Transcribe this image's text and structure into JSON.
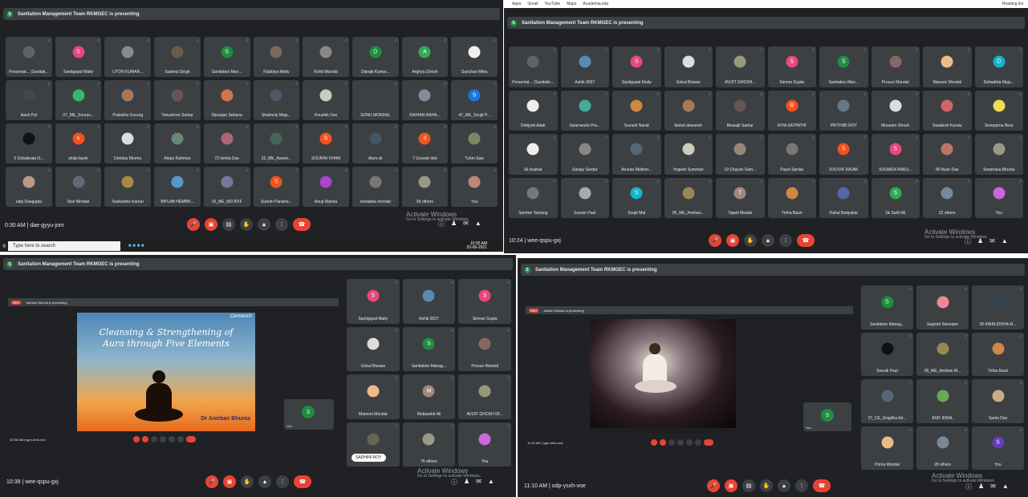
{
  "bookmarks": {
    "items": [
      "Apps",
      "Gmail",
      "YouTube",
      "Maps",
      "Academia.edu"
    ],
    "reading_list": "Reading list"
  },
  "presenting": "Sanitation Management Team RKMGEC is presenting",
  "activate": {
    "title": "Activate Windows",
    "sub": "Go to Settings to activate Windows."
  },
  "panel1": {
    "meeting": "0:30 AM | dae-gyyu-jom",
    "taskbar_search": "Type here to search",
    "taskbar_time": "10:30 AM",
    "taskbar_date": "20-06-2021",
    "tiles": [
      {
        "name": "Presentat... (Sanitati...",
        "letter": "",
        "color": "#5f6368"
      },
      {
        "name": "Santigopal Maity",
        "letter": "S",
        "color": "#e8477b"
      },
      {
        "name": "LITON KUMAR...",
        "letter": "",
        "color": "#8a8a8a"
      },
      {
        "name": "Sudeep Singh",
        "letter": "",
        "color": "#6b5b4a"
      },
      {
        "name": "Sanitation Man...",
        "letter": "S",
        "color": "#1e8e3e"
      },
      {
        "name": "Flabbiya Maity",
        "letter": "",
        "color": "#7a6a55"
      },
      {
        "name": "Rohit Mondal",
        "letter": "",
        "color": "#888"
      },
      {
        "name": "Diprajit Kumar...",
        "letter": "D",
        "color": "#1e8e3e"
      },
      {
        "name": "Arghya Ghosh",
        "letter": "A",
        "color": "#34a853"
      },
      {
        "name": "Sanchari Mitra",
        "letter": "",
        "color": "#eee"
      },
      {
        "name": "ikash Pal",
        "letter": "",
        "color": "#445"
      },
      {
        "name": "07_ME_Sourav...",
        "letter": "",
        "color": "#3b6"
      },
      {
        "name": "Pratistha Gurung",
        "letter": "",
        "color": "#a75"
      },
      {
        "name": "Tanushree Sarkar",
        "letter": "",
        "color": "#655"
      },
      {
        "name": "Dipanjan Sahana",
        "letter": "",
        "color": "#c74"
      },
      {
        "name": "Shalmoly Maju...",
        "letter": "",
        "color": "#556"
      },
      {
        "name": "Koushik Das",
        "letter": "",
        "color": "#ccb"
      },
      {
        "name": "SONU MONDAL",
        "letter": "",
        "color": "#3c4043"
      },
      {
        "name": "RAIHAN RAHA...",
        "letter": "",
        "color": "#889"
      },
      {
        "name": "47_ME_Soujit P...",
        "letter": "S",
        "color": "#1a73e8"
      },
      {
        "name": "0 Debabrata D...",
        "letter": "",
        "color": "#111"
      },
      {
        "name": "shilpi layek",
        "letter": "s",
        "color": "#f4511e"
      },
      {
        "name": "Debdas Murmu",
        "letter": "",
        "color": "#ddd"
      },
      {
        "name": "Atiqur Rahman",
        "letter": "",
        "color": "#687"
      },
      {
        "name": "72 Ismita Das",
        "letter": "",
        "color": "#a67"
      },
      {
        "name": "32_ME_Aswini...",
        "letter": "",
        "color": "#465"
      },
      {
        "name": "SOURAV KHAN",
        "letter": "S",
        "color": "#f4511e"
      },
      {
        "name": "Alam sk",
        "letter": "",
        "color": "#456"
      },
      {
        "name": "7 Gourab deb",
        "letter": "d",
        "color": "#f4511e"
      },
      {
        "name": "Tuhin Saw",
        "letter": "",
        "color": "#786"
      },
      {
        "name": "udip Dasgupta",
        "letter": "",
        "color": "#b98"
      },
      {
        "name": "Sisir Mondal",
        "letter": "",
        "color": "#667"
      },
      {
        "name": "Snahashis Kanrar",
        "letter": "",
        "color": "#a84"
      },
      {
        "name": "BIPLAB HEMBR...",
        "letter": "",
        "color": "#59c"
      },
      {
        "name": "19_ME_MD ATIF",
        "letter": "",
        "color": "#779"
      },
      {
        "name": "Suresh Parama...",
        "letter": "S",
        "color": "#f4511e"
      },
      {
        "name": "Anup Manna",
        "letter": "",
        "color": "#a4c"
      },
      {
        "name": "monalisa mondal",
        "letter": "",
        "color": "#777"
      },
      {
        "name": "56 others",
        "letter": "",
        "color": "#998"
      },
      {
        "name": "You",
        "letter": "",
        "color": "#b87"
      }
    ]
  },
  "panel2": {
    "meeting": "10:24 | wee-qspu-gxj",
    "tiles": [
      {
        "name": "Presentat... (Sanitatio...",
        "letter": "",
        "color": "#5f6368"
      },
      {
        "name": "Ashik 9037",
        "letter": "",
        "color": "#5a8ab0"
      },
      {
        "name": "Santigopal Maity",
        "letter": "S",
        "color": "#e8477b"
      },
      {
        "name": "Gokul Biswas",
        "letter": "",
        "color": "#ddd"
      },
      {
        "name": "AVIJIT GHOSH...",
        "letter": "",
        "color": "#997"
      },
      {
        "name": "Simran Gupta",
        "letter": "S",
        "color": "#e8477b"
      },
      {
        "name": "Sanitation Man...",
        "letter": "S",
        "color": "#1e8e3e"
      },
      {
        "name": "Prosun Mandal",
        "letter": "",
        "color": "#866"
      },
      {
        "name": "Mamoni Mondal",
        "letter": "",
        "color": "#eb8"
      },
      {
        "name": "Debadrita Maju...",
        "letter": "D",
        "color": "#12b5cb"
      },
      {
        "name": "Debjyoti Adak",
        "letter": "",
        "color": "#eee"
      },
      {
        "name": "Swarnendu Pra...",
        "letter": "",
        "color": "#4a9"
      },
      {
        "name": "Suvanil Nandi",
        "letter": "",
        "color": "#c84"
      },
      {
        "name": "bishal dewansh",
        "letter": "",
        "color": "#a75"
      },
      {
        "name": "Biswajit Sarkar",
        "letter": "",
        "color": "#655"
      },
      {
        "name": "RIYA SATPATHI",
        "letter": "R",
        "color": "#f4511e"
      },
      {
        "name": "PRITHIBI ROY",
        "letter": "",
        "color": "#678"
      },
      {
        "name": "Mousam Ghosh",
        "letter": "",
        "color": "#ddd"
      },
      {
        "name": "Swadesh Kundu",
        "letter": "",
        "color": "#c66"
      },
      {
        "name": "Sreeparna Bera",
        "letter": "",
        "color": "#ed5"
      },
      {
        "name": "Sk Azahar",
        "letter": "",
        "color": "#eee"
      },
      {
        "name": "Sanjay Sardar",
        "letter": "",
        "color": "#888"
      },
      {
        "name": "Anuran Mukher...",
        "letter": "",
        "color": "#567"
      },
      {
        "name": "Yogesh Summan",
        "letter": "",
        "color": "#ccb"
      },
      {
        "name": "19 Chayan Sam...",
        "letter": "",
        "color": "#987"
      },
      {
        "name": "Payel Sardar",
        "letter": "",
        "color": "#777"
      },
      {
        "name": "SOUVIK RAJAK",
        "letter": "S",
        "color": "#f4511e"
      },
      {
        "name": "SOUMEN ANKU...",
        "letter": "S",
        "color": "#e8477b"
      },
      {
        "name": "80 Ayan Das",
        "letter": "",
        "color": "#b76"
      },
      {
        "name": "Swarnava Bhunia",
        "letter": "",
        "color": "#998"
      },
      {
        "name": "Samten Tamang",
        "letter": "",
        "color": "#777"
      },
      {
        "name": "Suman Paul",
        "letter": "",
        "color": "#aaa"
      },
      {
        "name": "Soujit Mal",
        "letter": "S",
        "color": "#12b5cb"
      },
      {
        "name": "05_ME_Anirban...",
        "letter": "",
        "color": "#985"
      },
      {
        "name": "Tapati Modak",
        "letter": "T",
        "color": "#a1887f"
      },
      {
        "name": "Tirtha Bauri",
        "letter": "",
        "color": "#c84"
      },
      {
        "name": "Rahul Badyakar",
        "letter": "",
        "color": "#56a"
      },
      {
        "name": "Sk Sahil Ali",
        "letter": "S",
        "color": "#34a853"
      },
      {
        "name": "22 others",
        "letter": "",
        "color": "#789"
      },
      {
        "name": "You",
        "letter": "",
        "color": "#c6d"
      }
    ]
  },
  "panel3": {
    "meeting": "10:38 | wee-qspu-gxj",
    "rec": "REC",
    "presenter_note": "Anirban Bhunia is presenting",
    "slide_title": "Cleansing & Strengthening of Aura through Five Elements",
    "slide_author": "Dr Anirban Bhunia",
    "slide_logo": "Cemetrich",
    "inner_meeting": "10:36 AM | sgm-hrhs-ncd",
    "you": "You",
    "sadhini": "SADHINI ROY",
    "tiles": [
      {
        "name": "Santigopal Maity",
        "letter": "S",
        "color": "#e8477b"
      },
      {
        "name": "Ashik 9037",
        "letter": "",
        "color": "#5a8ab0"
      },
      {
        "name": "Simran Gupta",
        "letter": "S",
        "color": "#e8477b"
      },
      {
        "name": "Gokul Biswas",
        "letter": "",
        "color": "#ddd"
      },
      {
        "name": "Sanitation Manag...",
        "letter": "S",
        "color": "#1e8e3e"
      },
      {
        "name": "Prosun Mandal",
        "letter": "",
        "color": "#866"
      },
      {
        "name": "Mamoni Mondal",
        "letter": "",
        "color": "#eb8"
      },
      {
        "name": "Mubasshir Ali",
        "letter": "M",
        "color": "#a1887f"
      },
      {
        "name": "AVIJIT GHOSH 00...",
        "letter": "",
        "color": "#997"
      },
      {
        "name": "",
        "letter": "",
        "color": "#665"
      },
      {
        "name": "75 others",
        "letter": "",
        "color": "#998"
      },
      {
        "name": "You",
        "letter": "",
        "color": "#c6d"
      }
    ]
  },
  "panel4": {
    "meeting": "11:10 AM | odp-ysxh-voe",
    "rec": "REC",
    "presenter_note": "Ashish Kakwar is presenting",
    "inner_meeting": "11:10 AM | sgm-hrhs-ncd",
    "you": "You",
    "tiles": [
      {
        "name": "Sanitation Manag...",
        "letter": "S",
        "color": "#1e8e3e"
      },
      {
        "name": "Sagnick Banerjee",
        "letter": "",
        "color": "#e89"
      },
      {
        "name": "26 ANIRUDDHA M...",
        "letter": "",
        "color": "#345"
      },
      {
        "name": "Souvik Paul",
        "letter": "",
        "color": "#111"
      },
      {
        "name": "05_ME_Anirban M...",
        "letter": "",
        "color": "#985"
      },
      {
        "name": "Tirtha Bauri",
        "letter": "",
        "color": "#c84"
      },
      {
        "name": "37_CE_Snigdha Ad...",
        "letter": "",
        "color": "#567"
      },
      {
        "name": "ASIF IKBAL",
        "letter": "",
        "color": "#6a5"
      },
      {
        "name": "Santu Das",
        "letter": "",
        "color": "#ca8"
      },
      {
        "name": "Prima Mondal",
        "letter": "",
        "color": "#eb8"
      },
      {
        "name": "28 others",
        "letter": "",
        "color": "#789"
      },
      {
        "name": "You",
        "letter": "S",
        "color": "#673ab7"
      }
    ]
  }
}
